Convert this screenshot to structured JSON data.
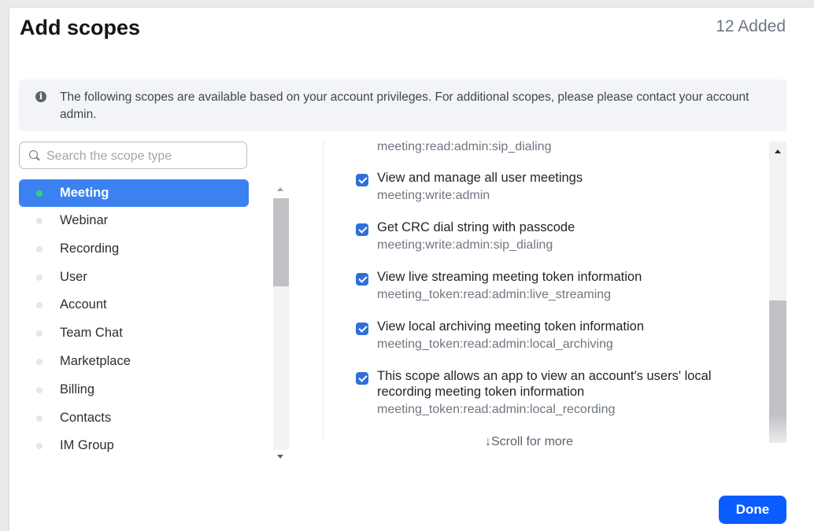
{
  "header": {
    "title": "Add scopes",
    "added_count": "12 Added"
  },
  "notice": {
    "icon": "info-icon",
    "text": "The following scopes are available based on your account privileges. For additional scopes, please please contact your account admin."
  },
  "search": {
    "placeholder": "Search the scope type",
    "value": ""
  },
  "categories": [
    {
      "label": "Meeting",
      "active": true
    },
    {
      "label": "Webinar",
      "active": false
    },
    {
      "label": "Recording",
      "active": false
    },
    {
      "label": "User",
      "active": false
    },
    {
      "label": "Account",
      "active": false
    },
    {
      "label": "Team Chat",
      "active": false
    },
    {
      "label": "Marketplace",
      "active": false
    },
    {
      "label": "Billing",
      "active": false
    },
    {
      "label": "Contacts",
      "active": false
    },
    {
      "label": "IM Group",
      "active": false
    }
  ],
  "scopes": {
    "top_code": "meeting:read:admin:sip_dialing",
    "items": [
      {
        "title": "View and manage all user meetings",
        "code": "meeting:write:admin",
        "checked": true
      },
      {
        "title": "Get CRC dial string with passcode",
        "code": "meeting:write:admin:sip_dialing",
        "checked": true
      },
      {
        "title": "View live streaming meeting token information",
        "code": "meeting_token:read:admin:live_streaming",
        "checked": true
      },
      {
        "title": "View local archiving meeting token information",
        "code": "meeting_token:read:admin:local_archiving",
        "checked": true
      },
      {
        "title": "This scope allows an app to view an account's users' local recording meeting token information",
        "code": "meeting_token:read:admin:local_recording",
        "checked": true
      }
    ]
  },
  "scroll_hint": "↓Scroll for more",
  "footer": {
    "done_label": "Done"
  },
  "colors": {
    "primary": "#0b5cff",
    "active_item": "#3b82f0",
    "active_dot": "#33d17a",
    "checkbox": "#2f6fdc"
  }
}
